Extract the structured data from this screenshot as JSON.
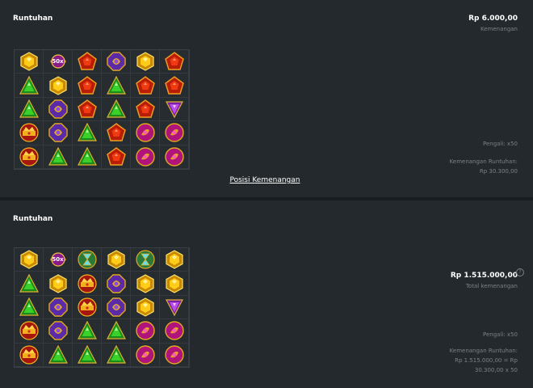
{
  "colors": {
    "background": "#1b1e21",
    "panel": "#24292d",
    "muted_text": "#7a8288"
  },
  "panel1": {
    "title": "Runtuhan",
    "amount": "Rp 6.000,00",
    "amount_label": "Kemenangan",
    "multiplier": "Pengali: x50",
    "cascade_label": "Kemenangan Runtuhan:",
    "cascade_value": "Rp 30.300,00",
    "link": "Posisi Kemenangan",
    "grid": [
      [
        "hex-gold",
        "mult-50",
        "pent-red",
        "oct-purple",
        "hex-gold",
        "pent-red"
      ],
      [
        "tri-green",
        "hex-gold",
        "pent-red",
        "tri-green",
        "pent-red",
        "pent-red"
      ],
      [
        "tri-green",
        "oct-purple",
        "pent-red",
        "tri-green",
        "pent-red",
        "tri-purple"
      ],
      [
        "crown-red",
        "oct-purple",
        "tri-green",
        "pent-red",
        "circle-magenta",
        "circle-magenta"
      ],
      [
        "crown-red",
        "tri-green",
        "tri-green",
        "pent-red",
        "circle-magenta",
        "circle-magenta"
      ]
    ]
  },
  "panel2": {
    "title": "Runtuhan",
    "amount": "Rp 1.515.000,00",
    "amount_label": "Total kemenangan",
    "help": "?",
    "multiplier": "Pengali: x50",
    "cascade_label": "Kemenangan Runtuhan:",
    "cascade_value_1": "Rp 1.515.000,00 = Rp",
    "cascade_value_2": "30.300,00 x 50",
    "grid": [
      [
        "hex-gold",
        "mult-50",
        "hourglass-green",
        "hex-gold",
        "hourglass-green",
        "hex-gold"
      ],
      [
        "tri-green",
        "hex-gold",
        "crown-red",
        "oct-purple",
        "hex-gold",
        "hex-gold"
      ],
      [
        "tri-green",
        "oct-purple",
        "crown-red",
        "oct-purple",
        "hex-gold",
        "tri-purple"
      ],
      [
        "crown-red",
        "oct-purple",
        "tri-green",
        "tri-green",
        "circle-magenta",
        "circle-magenta"
      ],
      [
        "crown-red",
        "tri-green",
        "tri-green",
        "tri-green",
        "circle-magenta",
        "circle-magenta"
      ]
    ]
  },
  "multiplier_symbol_text": "50x"
}
